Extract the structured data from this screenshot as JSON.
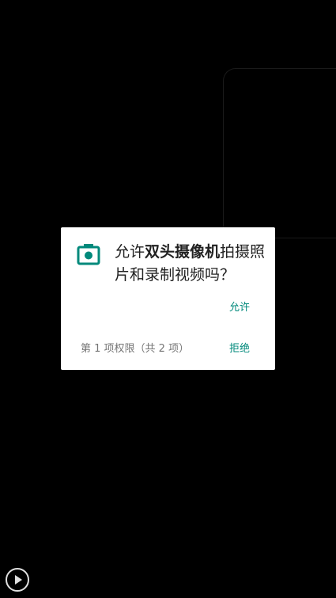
{
  "dialog": {
    "message_prefix": "允许",
    "app_name": "双头摄像机",
    "message_suffix": "拍摄照片和录制视频吗？",
    "allow_label": "允许",
    "deny_label": "拒绝",
    "counter_text": "第 1 项权限（共 2 项）",
    "icon": "camera-icon"
  },
  "overlay": {
    "play_icon": "play-icon"
  },
  "colors": {
    "background": "#000000",
    "dialog_bg": "#ffffff",
    "accent": "#00897b",
    "text_primary": "#212121",
    "text_secondary": "#757575"
  }
}
